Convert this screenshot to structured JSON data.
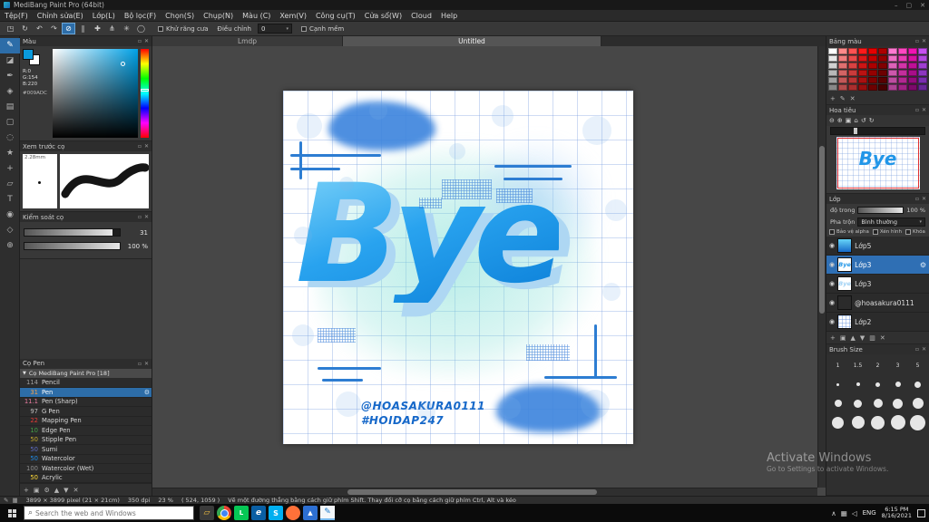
{
  "ui": {
    "caret": "▾",
    "collapse": "▼",
    "dock_icon": "▫",
    "close_icon": "✕",
    "eye_icon": "◉",
    "gear_icon": "⚙",
    "search_icon": "⌕"
  },
  "colors": {
    "accent": "#2d7dd2",
    "selection": "#2d6da8",
    "current_color": "#0A9ADC"
  },
  "titlebar": {
    "title": "MediBang Paint Pro (64bit)",
    "minimize_icon": "–",
    "maximize_icon": "▢",
    "close_icon": "✕"
  },
  "menubar": {
    "items": [
      "Tệp(F)",
      "Chỉnh sửa(E)",
      "Lớp(L)",
      "Bộ lọc(F)",
      "Chọn(S)",
      "Chụp(N)",
      "Màu (C)",
      "Xem(V)",
      "Công cụ(T)",
      "Cửa sổ(W)",
      "Cloud",
      "Help"
    ]
  },
  "toolbar": {
    "icons": [
      {
        "name": "transform-icon",
        "glyph": "◳"
      },
      {
        "name": "rotate-canvas-icon",
        "glyph": "↻"
      },
      {
        "name": "undo-icon",
        "glyph": "↶"
      },
      {
        "name": "redo-icon",
        "glyph": "↷"
      },
      {
        "name": "snap-off-icon",
        "glyph": "⊘",
        "active": true
      },
      {
        "name": "snap-parallel-icon",
        "glyph": "∥"
      },
      {
        "name": "snap-crisscross-icon",
        "glyph": "✚"
      },
      {
        "name": "snap-vanishing-point-icon",
        "glyph": "⋔"
      },
      {
        "name": "snap-radial-icon",
        "glyph": "✳"
      },
      {
        "name": "snap-ellipse-icon",
        "glyph": "◯"
      }
    ],
    "antialias_label": "Khử răng cưa",
    "correction_label": "Điều chỉnh",
    "correction_value": "0",
    "soft_edge_label": "Cạnh mềm"
  },
  "toolstrip": {
    "tools": [
      {
        "name": "brush-tool-icon",
        "glyph": "✎",
        "active": true
      },
      {
        "name": "eraser-tool-icon",
        "glyph": "◪"
      },
      {
        "name": "pen-tool-icon",
        "glyph": "✒"
      },
      {
        "name": "bucket-tool-icon",
        "glyph": "◈"
      },
      {
        "name": "gradient-tool-icon",
        "glyph": "▤"
      },
      {
        "name": "select-tool-icon",
        "glyph": "▢"
      },
      {
        "name": "lasso-tool-icon",
        "glyph": "◌"
      },
      {
        "name": "wand-tool-icon",
        "glyph": "★"
      },
      {
        "name": "move-tool-icon",
        "glyph": "+"
      },
      {
        "name": "shape-tool-icon",
        "glyph": "▱"
      },
      {
        "name": "text-tool-icon",
        "glyph": "T"
      },
      {
        "name": "eyedropper-tool-icon",
        "glyph": "◉"
      },
      {
        "name": "hand-tool-icon",
        "glyph": "◇"
      },
      {
        "name": "zoom-tool-icon",
        "glyph": "⊕"
      }
    ]
  },
  "left_panels": {
    "color": {
      "title": "Màu",
      "r": "R:0",
      "g": "G:154",
      "b": "B:220",
      "hex": "#009ADC"
    },
    "brush_preview": {
      "title": "Xem trước cọ",
      "size_label": "2.28mm"
    },
    "brush_control": {
      "title": "Kiểm soát cọ",
      "size_value": "31",
      "opacity_value": "100 %"
    },
    "brush_list": {
      "title": "Cọ Pen",
      "group_label": "Cọ MediBang Paint Pro [18]",
      "items": [
        {
          "size": "114",
          "name": "Pencil",
          "tag": "#9e9e9e"
        },
        {
          "size": "31",
          "name": "Pen",
          "tag": "#f0a050",
          "selected": true
        },
        {
          "size": "11.1",
          "name": "Pen (Sharp)",
          "tag": "#e87ca0"
        },
        {
          "size": "97",
          "name": "G Pen",
          "tag": "#bdbdbd"
        },
        {
          "size": "22",
          "name": "Mapping Pen",
          "tag": "#e53935"
        },
        {
          "size": "10",
          "name": "Edge Pen",
          "tag": "#43a047"
        },
        {
          "size": "50",
          "name": "Stipple Pen",
          "tag": "#c0a62c"
        },
        {
          "size": "50",
          "name": "Sumi",
          "tag": "#5c6bc0"
        },
        {
          "size": "50",
          "name": "Watercolor",
          "tag": "#1e88e5"
        },
        {
          "size": "100",
          "name": "Watercolor (Wet)",
          "tag": "#8d8d8d"
        },
        {
          "size": "50",
          "name": "Acrylic",
          "tag": "#fdd835"
        }
      ],
      "footer_icons": [
        {
          "name": "add-brush-icon",
          "glyph": "+"
        },
        {
          "name": "duplicate-brush-icon",
          "glyph": "▣"
        },
        {
          "name": "brush-settings-icon",
          "glyph": "⚙"
        },
        {
          "name": "move-up-icon",
          "glyph": "▲"
        },
        {
          "name": "move-down-icon",
          "glyph": "▼"
        },
        {
          "name": "delete-brush-icon",
          "glyph": "✕"
        }
      ]
    }
  },
  "canvas": {
    "tabs": [
      {
        "label": "Lmdp"
      },
      {
        "label": "Untitled"
      }
    ],
    "artwork": {
      "main_text": "Bye",
      "credit1": "@HOASAKURA0111",
      "credit2": "#HOIDAP247"
    }
  },
  "right_panels": {
    "palette": {
      "title": "Bảng màu",
      "colors": [
        "#ffffff",
        "#ff8a8a",
        "#ff5252",
        "#ff1a1a",
        "#e60000",
        "#ad0000",
        "#ff7ad1",
        "#ff47c2",
        "#f014b2",
        "#c650f0",
        "#e8e8e8",
        "#f07d7d",
        "#ea4a4a",
        "#dc1818",
        "#c40000",
        "#940000",
        "#ef6ec4",
        "#e93bb4",
        "#d712a2",
        "#b347e0",
        "#d0d0d0",
        "#e17070",
        "#da4242",
        "#cc1515",
        "#ac0000",
        "#800000",
        "#de62b8",
        "#d434a8",
        "#bf1096",
        "#9f3ed0",
        "#b8b8b8",
        "#d26464",
        "#ca3b3b",
        "#bb1212",
        "#950000",
        "#6d0000",
        "#cd57ac",
        "#c32e9c",
        "#a80e89",
        "#8c36c0",
        "#a0a0a0",
        "#c35858",
        "#bb3434",
        "#aa1010",
        "#800000",
        "#5a0000",
        "#bd4da0",
        "#b22891",
        "#920c7c",
        "#7a2eb0",
        "#888888",
        "#b44d4d",
        "#ab2e2e",
        "#990e0e",
        "#6d0000",
        "#480000",
        "#ad4394",
        "#a12385",
        "#7d0a6b",
        "#682798"
      ],
      "footer_icons": [
        {
          "name": "add-color-icon",
          "glyph": "+"
        },
        {
          "name": "edit-color-icon",
          "glyph": "✎"
        },
        {
          "name": "delete-color-icon",
          "glyph": "✕"
        }
      ]
    },
    "navigator": {
      "title": "Hoa tiêu",
      "icons": [
        {
          "name": "zoom-out-icon",
          "glyph": "⊖"
        },
        {
          "name": "zoom-in-icon",
          "glyph": "⊕"
        },
        {
          "name": "fit-screen-icon",
          "glyph": "▣"
        },
        {
          "name": "actual-size-icon",
          "glyph": "⌂"
        },
        {
          "name": "rotate-left-icon",
          "glyph": "↺"
        },
        {
          "name": "rotate-right-icon",
          "glyph": "↻"
        }
      ]
    },
    "layers": {
      "title": "Lớp",
      "opacity_label": "độ trong",
      "opacity_value": "100 %",
      "blend_label": "Pha trộn",
      "blend_value": "Bình thường",
      "checkboxes": [
        "Bảo vệ alpha",
        "Xén hình",
        "Khóa"
      ],
      "items": [
        {
          "name": "Lớp5",
          "thumb": "gradient"
        },
        {
          "name": "Lớp3",
          "thumb": "bye",
          "selected": true
        },
        {
          "name": "Lớp3",
          "thumb": "bye2"
        },
        {
          "name": "@hoasakura0111",
          "thumb": "dark"
        },
        {
          "name": "Lớp2",
          "thumb": "grid"
        }
      ],
      "footer_icons": [
        {
          "name": "add-layer-icon",
          "glyph": "+"
        },
        {
          "name": "layer-folder-icon",
          "glyph": "▣"
        },
        {
          "name": "layer-up-icon",
          "glyph": "▲"
        },
        {
          "name": "layer-down-icon",
          "glyph": "▼"
        },
        {
          "name": "merge-layer-icon",
          "glyph": "▥"
        },
        {
          "name": "delete-layer-icon",
          "glyph": "✕"
        }
      ]
    },
    "brush_size": {
      "title": "Brush Size",
      "labels": [
        "1",
        "1.5",
        "2",
        "3",
        "5"
      ],
      "dots": [
        3,
        4,
        5,
        6,
        7,
        8,
        9,
        10,
        11,
        12,
        13,
        14,
        15,
        16,
        17
      ]
    }
  },
  "statusbar": {
    "icons": [
      {
        "name": "pen-status-icon",
        "glyph": "✎"
      },
      {
        "name": "grid-status-icon",
        "glyph": "▦"
      }
    ],
    "dimensions": "3899 × 3899 pixel  (21 × 21cm)",
    "dpi": "350 dpi",
    "zoom": "23 %",
    "coords": "( 524, 1059 )",
    "hint": "Vẽ một đường thẳng bằng cách giữ phím Shift. Thay đổi cỡ cọ bằng cách giữ phím Ctrl, Alt và kéo"
  },
  "watermark": {
    "line1": "Activate Windows",
    "line2": "Go to Settings to activate Windows."
  },
  "taskbar": {
    "search_placeholder": "Search the web and Windows",
    "apps": [
      {
        "name": "file-explorer",
        "style": "explorer",
        "glyph": "▱"
      },
      {
        "name": "chrome",
        "style": "chrome",
        "glyph": ""
      },
      {
        "name": "line-app",
        "style": "line",
        "glyph": "L"
      },
      {
        "name": "edge",
        "style": "edge",
        "glyph": "e"
      },
      {
        "name": "skype",
        "style": "skype",
        "glyph": "S"
      },
      {
        "name": "firefox",
        "style": "firefox",
        "glyph": ""
      },
      {
        "name": "photos",
        "style": "photos",
        "glyph": "▲"
      },
      {
        "name": "medibang",
        "style": "medibang",
        "glyph": "✎",
        "active": true
      }
    ],
    "tray_icons": [
      {
        "name": "hidden-icons-chevron",
        "glyph": "∧"
      },
      {
        "name": "touch-keyboard-icon",
        "glyph": "▦"
      },
      {
        "name": "volume-icon",
        "glyph": "◁"
      }
    ],
    "lang": "ENG",
    "time": "6:15 PM",
    "date": "8/16/2021"
  }
}
